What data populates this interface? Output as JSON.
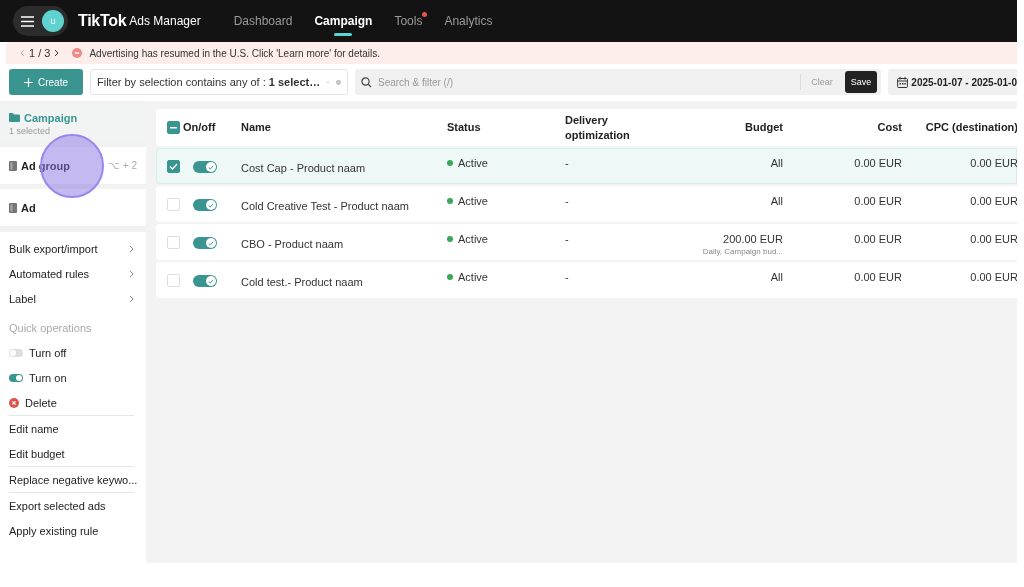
{
  "top_bar": {
    "avatar": "u",
    "logo": "TikTok",
    "logo_suffix": "Ads Manager",
    "nav": [
      {
        "label": "Dashboard",
        "selected": false,
        "notification": false
      },
      {
        "label": "Campaign",
        "selected": true,
        "notification": false
      },
      {
        "label": "Tools",
        "selected": false,
        "notification": true
      },
      {
        "label": "Analytics",
        "selected": false,
        "notification": false
      }
    ]
  },
  "banner": {
    "pager": "1 / 3",
    "message": "Advertising has resumed in the U.S. Click 'Learn more' for details."
  },
  "toolbar": {
    "create": "Create",
    "filter": "Filter by selection contains any of : **1 select…**",
    "search_placeholder": "Search & filter (/)",
    "clear": "Clear",
    "save": "Save",
    "date_range": "2025-01-07 - 2025-01-0"
  },
  "sidebar": {
    "levels": [
      {
        "kind": "folder",
        "label": "Campaign",
        "note": "1 selected",
        "selected": true
      },
      {
        "kind": "page",
        "label": "Ad group",
        "shortcut": "⌥ + 2",
        "selected": false
      },
      {
        "kind": "page",
        "label": "Ad",
        "selected": false
      }
    ],
    "menu_sections": [
      {
        "items": [
          {
            "kind": "submenu",
            "label": "Bulk export/import"
          },
          {
            "kind": "submenu",
            "label": "Automated rules"
          },
          {
            "kind": "submenu",
            "label": "Label"
          }
        ]
      },
      {
        "items": [
          {
            "kind": "heading",
            "label": "Quick operations"
          },
          {
            "kind": "toggle",
            "label": "Turn off",
            "on": false
          },
          {
            "kind": "toggle",
            "label": "Turn on",
            "on": true
          },
          {
            "kind": "delete",
            "label": "Delete"
          }
        ]
      },
      {
        "items": [
          {
            "kind": "action",
            "label": "Edit name"
          },
          {
            "kind": "action",
            "label": "Edit budget"
          }
        ]
      },
      {
        "items": [
          {
            "kind": "action",
            "label": "Replace negative keywo..."
          }
        ]
      },
      {
        "items": [
          {
            "kind": "action",
            "label": "Export selected ads"
          },
          {
            "kind": "action",
            "label": "Apply existing rule"
          }
        ]
      }
    ]
  },
  "table": {
    "select_all": {
      "indeterminate": true
    },
    "columns": [
      "On/off",
      "Name",
      "Status",
      "Delivery\noptimization",
      "Budget",
      "Cost",
      "CPC (destination)"
    ],
    "rows": [
      {
        "selected": true,
        "on": true,
        "name": "Cost Cap - Product naam",
        "status": "Active",
        "color": "#3aa757",
        "delivery": "-",
        "budget": "All",
        "cost": "0.00 EUR",
        "cpc": "0.00 EUR"
      },
      {
        "selected": false,
        "on": true,
        "name": "Cold Creative Test - Product naam",
        "status": "Active",
        "color": "#3aa757",
        "delivery": "-",
        "budget": "All",
        "cost": "0.00 EUR",
        "cpc": "0.00 EUR"
      },
      {
        "selected": false,
        "on": true,
        "name": "CBO - Product naam",
        "status": "Active",
        "color": "#3aa757",
        "delivery": "-",
        "budget": "200.00 EUR",
        "budget_note": "Daily, Campaign bud...",
        "cost": "0.00 EUR",
        "cpc": "0.00 EUR"
      },
      {
        "selected": false,
        "on": true,
        "name": "Cold test.- Product naam",
        "status": "Active",
        "color": "#3aa757",
        "delivery": "-",
        "budget": "All",
        "cost": "0.00 EUR",
        "cpc": "0.00 EUR"
      }
    ]
  }
}
